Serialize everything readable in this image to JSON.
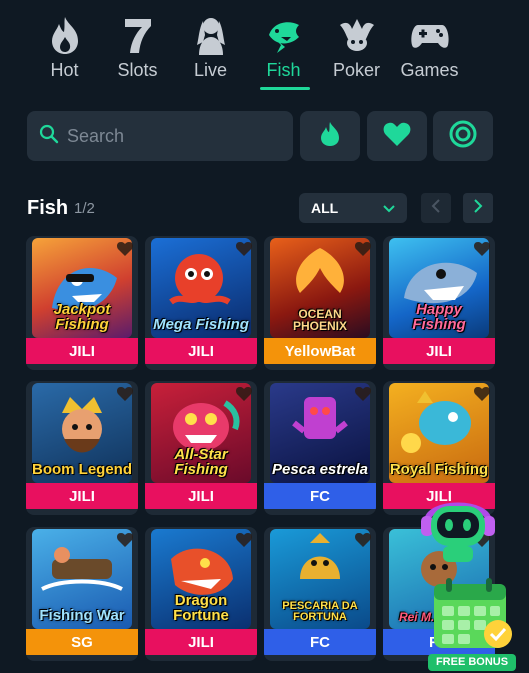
{
  "nav": {
    "categories": [
      {
        "label": "Hot",
        "icon": "flame-icon"
      },
      {
        "label": "Slots",
        "icon": "seven-icon"
      },
      {
        "label": "Live",
        "icon": "dealer-icon"
      },
      {
        "label": "Fish",
        "icon": "fish-icon",
        "active": true
      },
      {
        "label": "Poker",
        "icon": "joker-icon"
      },
      {
        "label": "Games",
        "icon": "gamepad-icon"
      }
    ]
  },
  "search": {
    "placeholder": "Search"
  },
  "filters": [
    "flame-icon",
    "heart-icon",
    "clock-icon"
  ],
  "section": {
    "title": "Fish",
    "page": "1/2",
    "filter_value": "ALL"
  },
  "colors": {
    "accent": "#1fd89a",
    "jili": "#e8105f",
    "yellowbat": "#f4930a",
    "fc": "#2f5fe8",
    "sg": "#f4930a"
  },
  "games": [
    {
      "title": "Jackpot Fishing",
      "provider": "JILI"
    },
    {
      "title": "Mega Fishing",
      "provider": "JILI"
    },
    {
      "title": "OCEAN PHOENIX",
      "provider": "YellowBat"
    },
    {
      "title": "Happy Fishing",
      "provider": "JILI"
    },
    {
      "title": "Boom Legend",
      "provider": "JILI"
    },
    {
      "title": "All-Star Fishing",
      "provider": "JILI"
    },
    {
      "title": "Pesca estrela",
      "provider": "FC"
    },
    {
      "title": "Royal Fishing",
      "provider": "JILI"
    },
    {
      "title": "Fishing War",
      "provider": "SG"
    },
    {
      "title": "Dragon Fortune",
      "provider": "JILI"
    },
    {
      "title": "PESCARIA DA FORTUNA",
      "provider": "FC"
    },
    {
      "title": "Rei M... Pesca",
      "provider": "FC"
    }
  ],
  "bonus": {
    "label": "FREE BONUS"
  }
}
